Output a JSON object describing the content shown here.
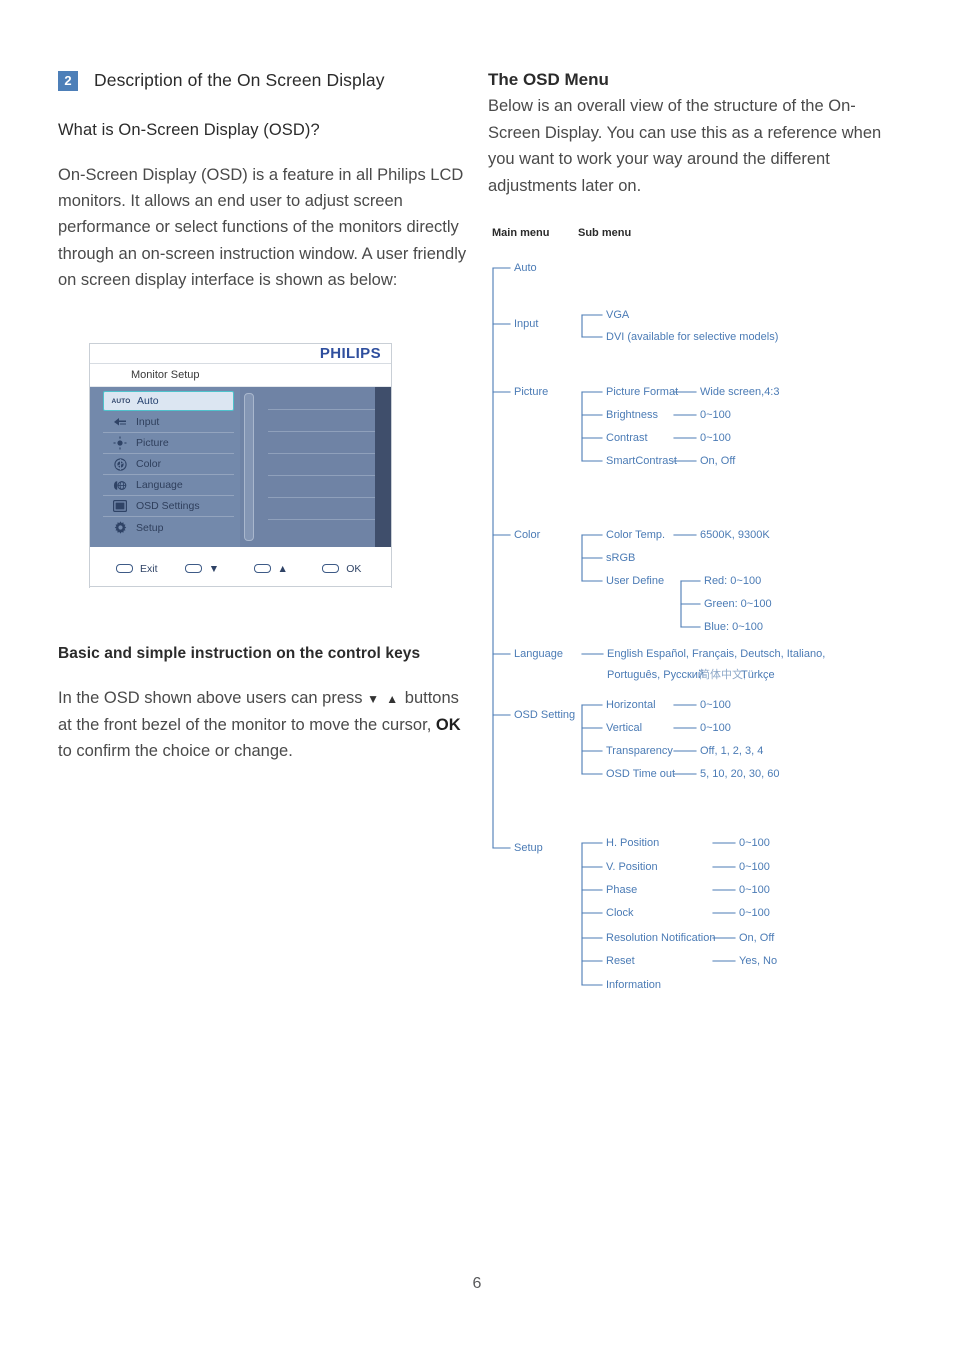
{
  "page": {
    "number": "6"
  },
  "left": {
    "section_badge": "2",
    "section_title": "Description of the On Screen Display",
    "subhead_1": "What is On-Screen Display (OSD)?",
    "paragraph_1": "On-Screen Display (OSD) is a feature in all Philips LCD monitors. It allows an end user to adjust screen performance or select functions of the monitors directly through an on-screen instruction window. A user friendly on screen display interface is shown as below:",
    "subhead_2": "Basic and simple instruction on the control keys",
    "paragraph_2_part1": "In the OSD shown above users can press",
    "paragraph_2_arrows": "▼ ▲",
    "paragraph_2_part2": "buttons at the front bezel of the monitor to move the cursor,",
    "paragraph_2_ok": "OK",
    "paragraph_2_part3": "to confirm the choice or change."
  },
  "right": {
    "heading": "The OSD Menu",
    "paragraph": "Below is an overall view of the structure of the On-Screen Display. You can use this as a reference when you want to work your way around the different adjustments later on."
  },
  "osd_mock": {
    "brand": "PHILIPS",
    "title": "Monitor Setup",
    "items": [
      {
        "label": "Auto",
        "icon": "auto-icon",
        "selected": true
      },
      {
        "label": "Input",
        "icon": "input-icon",
        "selected": false
      },
      {
        "label": "Picture",
        "icon": "brightness-icon",
        "selected": false
      },
      {
        "label": "Color",
        "icon": "color-wheel-icon",
        "selected": false
      },
      {
        "label": "Language",
        "icon": "language-icon",
        "selected": false
      },
      {
        "label": "OSD Settings",
        "icon": "osd-screen-icon",
        "selected": false
      },
      {
        "label": "Setup",
        "icon": "gear-icon",
        "selected": false
      }
    ],
    "footer_buttons": [
      {
        "label": "Exit",
        "glyph": ""
      },
      {
        "label": "",
        "glyph": "▼"
      },
      {
        "label": "",
        "glyph": "▲"
      },
      {
        "label": "OK",
        "glyph": ""
      }
    ],
    "colors": {
      "panel": "#6f83a5",
      "selected_border": "#4ec2cc",
      "brand": "#2f4f9e"
    }
  },
  "tree": {
    "col_header_main": "Main menu",
    "col_header_sub": "Sub menu",
    "accent": "#4b7bb5",
    "nodes": {
      "auto": "Auto",
      "input": "Input",
      "input_sub": [
        "VGA",
        "DVI (available for selective models)"
      ],
      "picture": "Picture",
      "picture_sub": [
        "Picture Format",
        "Brightness",
        "Contrast",
        "SmartContrast"
      ],
      "picture_val": [
        "Wide screen,4:3",
        "0~100",
        "0~100",
        "On, Off"
      ],
      "color": "Color",
      "color_sub": [
        "Color Temp.",
        "sRGB",
        "User Define"
      ],
      "color_temp_val": "6500K, 9300K",
      "user_define_val": [
        "Red: 0~100",
        "Green: 0~100",
        "Blue: 0~100"
      ],
      "language": "Language",
      "language_val_line1": "English  Español, Français, Deutsch, Italiano,",
      "language_val_line2a": "Português, Русский",
      "language_val_line2b": "简体中文,",
      "language_val_line2c": "Türkçe",
      "osd_setting": "OSD Setting",
      "osd_setting_sub": [
        "Horizontal",
        "Vertical",
        "Transparency",
        "OSD Time out"
      ],
      "osd_setting_val": [
        "0~100",
        "0~100",
        "Off, 1, 2, 3, 4",
        "5, 10, 20, 30, 60"
      ],
      "setup": "Setup",
      "setup_sub": [
        "H. Position",
        "V. Position",
        "Phase",
        "Clock",
        "Resolution Notification",
        "Reset",
        "Information"
      ],
      "setup_val": [
        "0~100",
        "0~100",
        "0~100",
        "0~100",
        "On, Off",
        "Yes, No",
        ""
      ]
    }
  }
}
